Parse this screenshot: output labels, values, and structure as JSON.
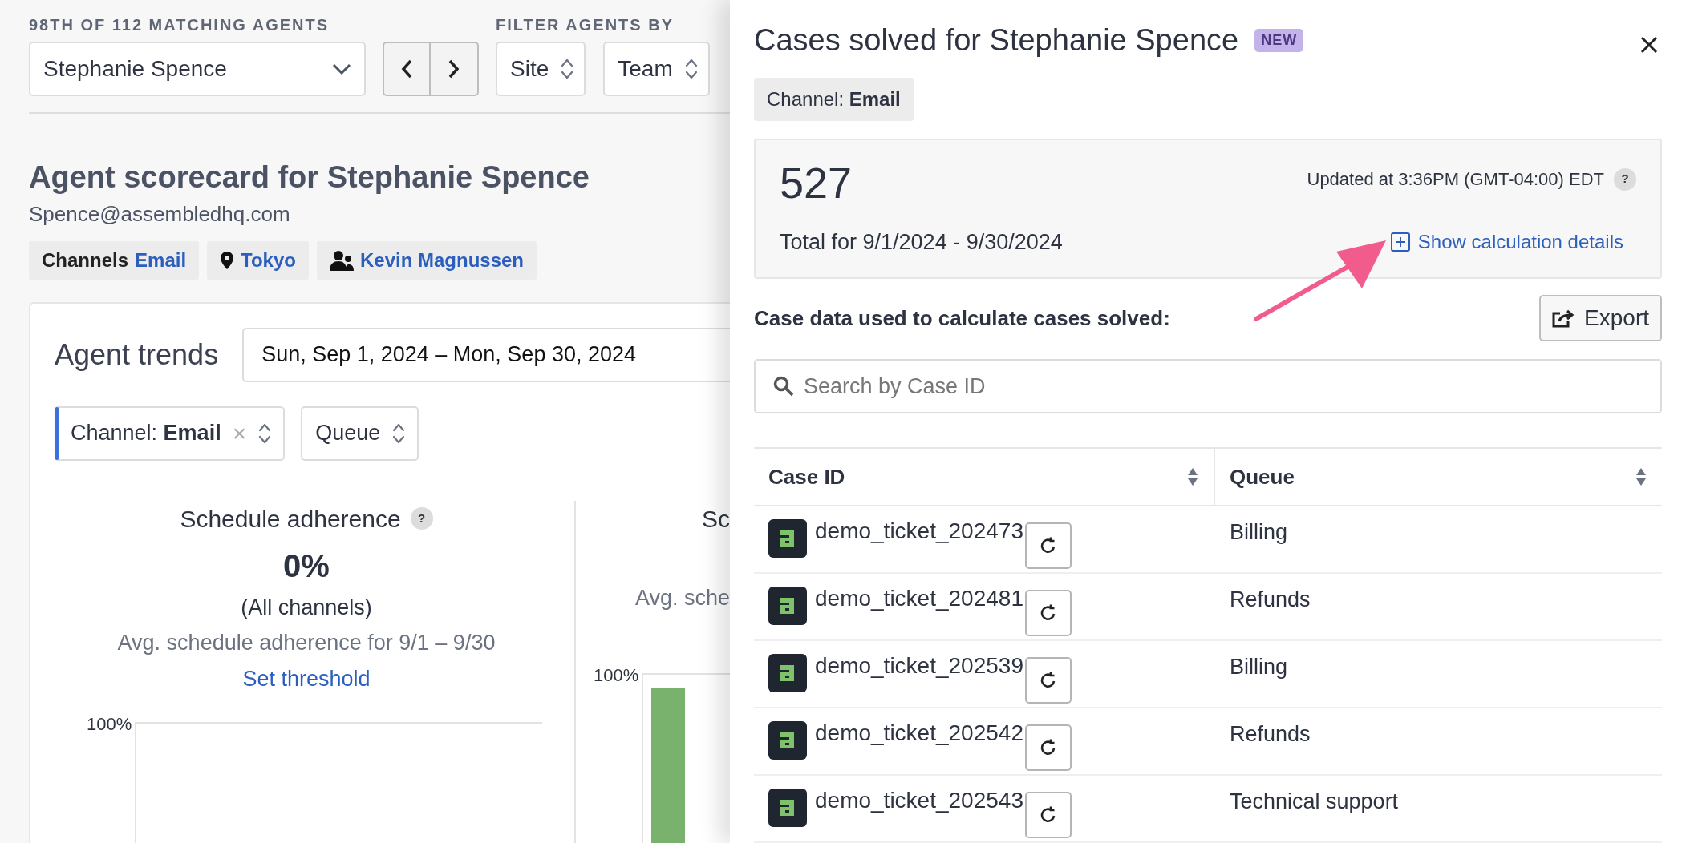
{
  "agent_picker": {
    "label": "98TH OF 112 MATCHING AGENTS",
    "value": "Stephanie Spence"
  },
  "filter": {
    "label": "FILTER AGENTS BY",
    "selects": [
      {
        "value": "Site"
      },
      {
        "value": "Team"
      }
    ]
  },
  "scorecard": {
    "title": "Agent scorecard for Stephanie Spence",
    "email": "Spence@assembledhq.com",
    "tags": [
      {
        "kind": "channels",
        "label": "Channels",
        "value": "Email"
      },
      {
        "kind": "location",
        "value": "Tokyo"
      },
      {
        "kind": "team",
        "value": "Kevin Magnussen"
      }
    ]
  },
  "trends": {
    "title": "Agent trends",
    "date_range": "Sun, Sep 1, 2024 – Mon, Sep 30, 2024",
    "filters": [
      {
        "kind": "active",
        "label": "Channel:",
        "value": "Email",
        "clear": "×"
      },
      {
        "kind": "plain",
        "value": "Queue"
      }
    ]
  },
  "metrics": [
    {
      "kind": "full",
      "title": "Schedule adherence",
      "help": "?",
      "value": "0%",
      "scope": "(All channels)",
      "caption": "Avg. schedule adherence for 9/1 – 9/30",
      "link": "Set threshold",
      "axis_label": "100%",
      "bar": false
    },
    {
      "kind": "cut",
      "title": "Sc",
      "caption": "Avg. sche",
      "axis_label": "100%",
      "bar": true
    }
  ],
  "panel": {
    "title": "Cases solved for Stephanie Spence",
    "badge": "NEW",
    "chip": {
      "label": "Channel:",
      "value": "Email"
    },
    "total": "527",
    "updated": "Updated at 3:36PM (GMT-04:00) EDT",
    "help": "?",
    "period": "Total for 9/1/2024 - 9/30/2024",
    "details_link": "Show calculation details",
    "section_title": "Case data used to calculate cases solved:",
    "export": "Export",
    "search": {
      "placeholder": "Search by Case ID"
    },
    "table": {
      "columns": [
        "Case ID",
        "Queue"
      ],
      "rows": [
        {
          "case_id": "demo_ticket_202473",
          "queue": "Billing"
        },
        {
          "case_id": "demo_ticket_202481",
          "queue": "Refunds"
        },
        {
          "case_id": "demo_ticket_202539",
          "queue": "Billing"
        },
        {
          "case_id": "demo_ticket_202542",
          "queue": "Refunds"
        },
        {
          "case_id": "demo_ticket_202543",
          "queue": "Technical support"
        }
      ]
    }
  }
}
